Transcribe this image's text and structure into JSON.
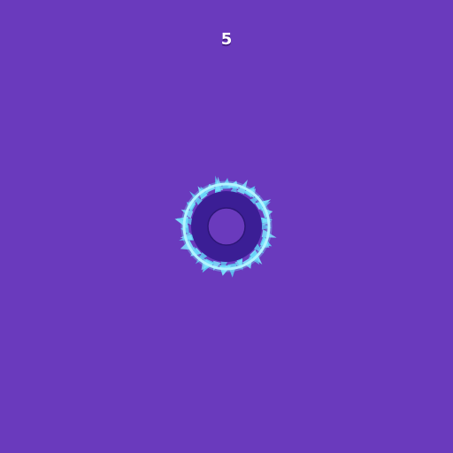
{
  "game": {
    "score": "5"
  },
  "colors": {
    "background": "#6a3abd",
    "ring_dark": "#3b1e95",
    "ring_hole": "#6a3abd",
    "glow_ring": "#cdfbff",
    "spikes": "#7fe8ff",
    "score_text": "#ffffff"
  },
  "icons": {
    "target": "spiked-glow-ring-icon"
  }
}
